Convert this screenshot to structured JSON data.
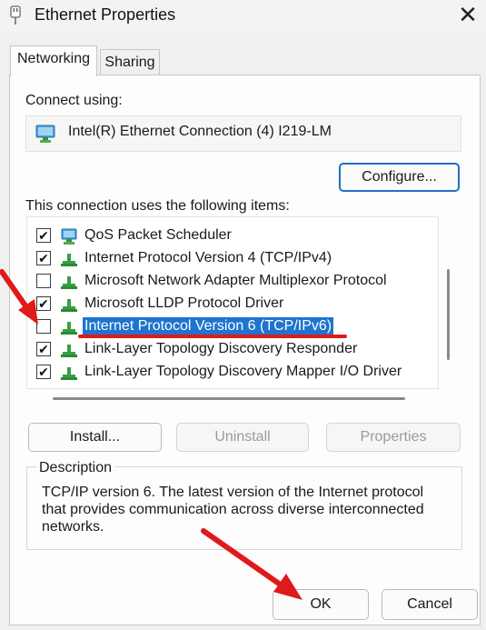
{
  "window": {
    "title": "Ethernet Properties",
    "close_glyph": "✕"
  },
  "tabs": [
    {
      "label": "Networking",
      "active": true
    },
    {
      "label": "Sharing",
      "active": false
    }
  ],
  "connect": {
    "label": "Connect using:",
    "adapter": "Intel(R) Ethernet Connection (4) I219-LM",
    "configure_button": "Configure..."
  },
  "items": {
    "label": "This connection uses the following items:",
    "rows": [
      {
        "label": "QoS Packet Scheduler",
        "checked": true,
        "icon": "qos-icon",
        "selected": false
      },
      {
        "label": "Internet Protocol Version 4 (TCP/IPv4)",
        "checked": true,
        "icon": "protocol-icon",
        "selected": false
      },
      {
        "label": "Microsoft Network Adapter Multiplexor Protocol",
        "checked": false,
        "icon": "protocol-icon",
        "selected": false
      },
      {
        "label": "Microsoft LLDP Protocol Driver",
        "checked": true,
        "icon": "protocol-icon",
        "selected": false
      },
      {
        "label": "Internet Protocol Version 6 (TCP/IPv6)",
        "checked": false,
        "icon": "protocol-icon",
        "selected": true
      },
      {
        "label": "Link-Layer Topology Discovery Responder",
        "checked": true,
        "icon": "protocol-icon",
        "selected": false
      },
      {
        "label": "Link-Layer Topology Discovery Mapper I/O Driver",
        "checked": true,
        "icon": "protocol-icon",
        "selected": false
      }
    ]
  },
  "actions": {
    "install": "Install...",
    "uninstall": "Uninstall",
    "properties": "Properties"
  },
  "description": {
    "legend": "Description",
    "text": "TCP/IP version 6. The latest version of the Internet protocol that provides communication across diverse interconnected networks."
  },
  "footer": {
    "ok": "OK",
    "cancel": "Cancel"
  },
  "colors": {
    "annotation": "#e0191b",
    "selection": "#1e74d0",
    "accent": "#1f6fc4"
  }
}
